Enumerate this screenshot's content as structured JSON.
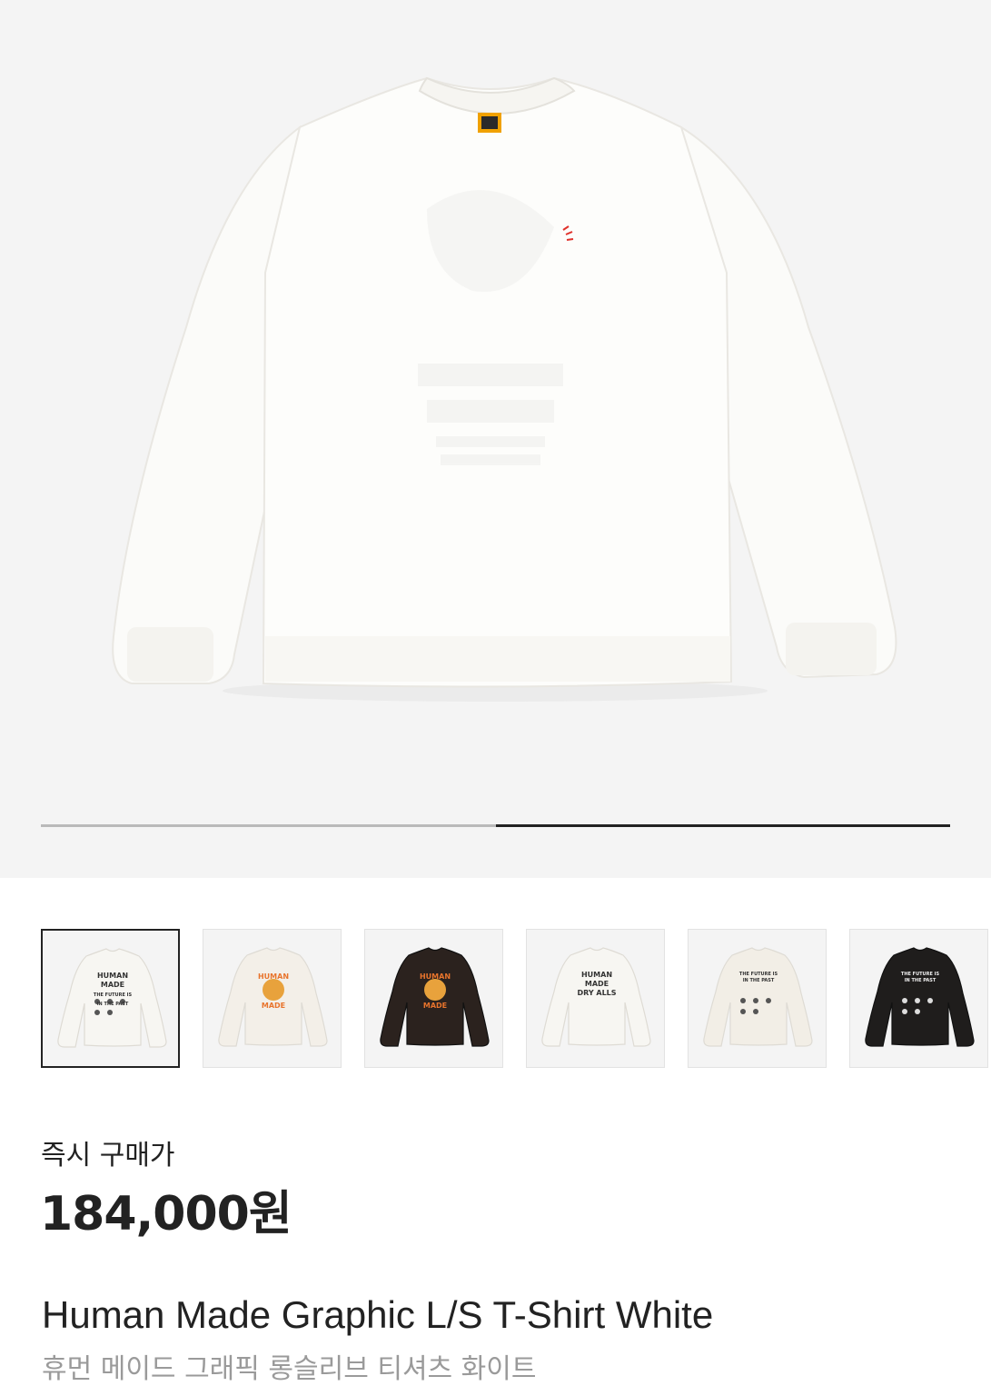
{
  "gallery": {
    "progress_fraction": 0.5,
    "main_image_icon": "white-long-sleeve-tshirt-with-red-heart-logo",
    "thumbnails": [
      {
        "icon": "white-tee-duck-graphic",
        "shirt_color": "#f7f6f2",
        "active": true,
        "lines": [
          "HUMAN",
          "MADE",
          "THE FUTURE IS",
          "IN THE PAST"
        ]
      },
      {
        "icon": "white-tee-tiger-graphic",
        "shirt_color": "#f3efe8",
        "active": false,
        "lines": [
          "HUMAN",
          "MADE"
        ]
      },
      {
        "icon": "black-tee-tiger-graphic",
        "shirt_color": "#2b221e",
        "active": false,
        "lines": [
          "HUMAN",
          "MADE"
        ]
      },
      {
        "icon": "white-tee-dry-alls-graphic",
        "shirt_color": "#f7f6f2",
        "active": false,
        "lines": [
          "HUMAN",
          "MADE",
          "DRY ALLS"
        ]
      },
      {
        "icon": "white-tee-ducks-future-graphic",
        "shirt_color": "#f2eee6",
        "active": false,
        "lines": [
          "THE FUTURE IS",
          "IN THE PAST"
        ]
      },
      {
        "icon": "black-tee-ducks-future-graphic",
        "shirt_color": "#1f1d1c",
        "active": false,
        "lines": [
          "THE FUTURE IS",
          "IN THE PAST"
        ]
      }
    ]
  },
  "colors": {
    "hero_bg": "#f4f4f4",
    "heart_red": "#e0312b",
    "tiger_orange": "#e8742c",
    "text_dark": "#222222",
    "text_gray": "#9a9a9a"
  },
  "product": {
    "price_label": "즉시 구매가",
    "price": "184,000원",
    "name_en": "Human Made Graphic L/S T-Shirt White",
    "name_ko": "휴먼 메이드 그래픽 롱슬리브 티셔츠 화이트"
  }
}
